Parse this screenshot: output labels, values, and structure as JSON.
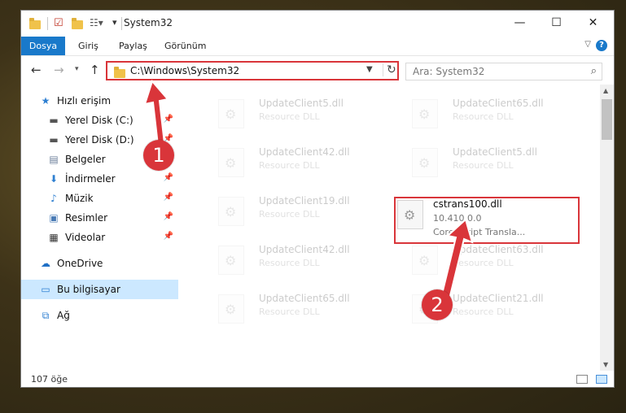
{
  "window": {
    "title": "System32",
    "controls": {
      "minimize": "—",
      "maximize": "☐",
      "close": "✕"
    }
  },
  "ribbon": {
    "tabs": [
      {
        "label": "Dosya",
        "active": true
      },
      {
        "label": "Giriş"
      },
      {
        "label": "Paylaş"
      },
      {
        "label": "Görünüm"
      }
    ]
  },
  "navigation": {
    "address": "C:\\Windows\\System32",
    "search_placeholder": "Ara: System32"
  },
  "sidebar": {
    "items": [
      {
        "label": "Hızlı erişim",
        "icon": "star-icon"
      },
      {
        "label": "Yerel Disk (C:)",
        "icon": "drive-icon",
        "pinned": true
      },
      {
        "label": "Yerel Disk (D:)",
        "icon": "drive-icon",
        "pinned": true
      },
      {
        "label": "Belgeler",
        "icon": "documents-icon",
        "pinned": true
      },
      {
        "label": "İndirmeler",
        "icon": "download-icon",
        "pinned": true
      },
      {
        "label": "Müzik",
        "icon": "music-icon",
        "pinned": true
      },
      {
        "label": "Resimler",
        "icon": "pictures-icon",
        "pinned": true
      },
      {
        "label": "Videolar",
        "icon": "videos-icon",
        "pinned": true
      },
      {
        "label": "OneDrive",
        "icon": "cloud-icon"
      },
      {
        "label": "Bu bilgisayar",
        "icon": "computer-icon",
        "selected": true
      },
      {
        "label": "Ağ",
        "icon": "network-icon"
      }
    ]
  },
  "files": [
    {
      "name": "UpdateClient5.dll",
      "type": "Resource DLL"
    },
    {
      "name": "UpdateClient65.dll",
      "type": "Resource DLL"
    },
    {
      "name": "UpdateClient42.dll",
      "type": "Resource DLL"
    },
    {
      "name": "UpdateClient5.dll",
      "type": "Resource DLL"
    },
    {
      "name": "UpdateClient19.dll",
      "type": "Resource DLL"
    },
    {
      "name": "cstrans100.dll",
      "version": "10.410.0.0",
      "description": "CorelScript Transla...",
      "highlighted": true
    },
    {
      "name": "UpdateClient42.dll",
      "type": "Resource DLL"
    },
    {
      "name": "UpdateClient63.dll",
      "type": "Resource DLL"
    },
    {
      "name": "UpdateClient65.dll",
      "type": "Resource DLL"
    },
    {
      "name": "UpdateClient21.dll",
      "type": "Resource DLL"
    }
  ],
  "status": {
    "item_count": "107 öğe"
  },
  "annotations": {
    "badge1": "1",
    "badge2": "2",
    "color": "#d9353a"
  }
}
